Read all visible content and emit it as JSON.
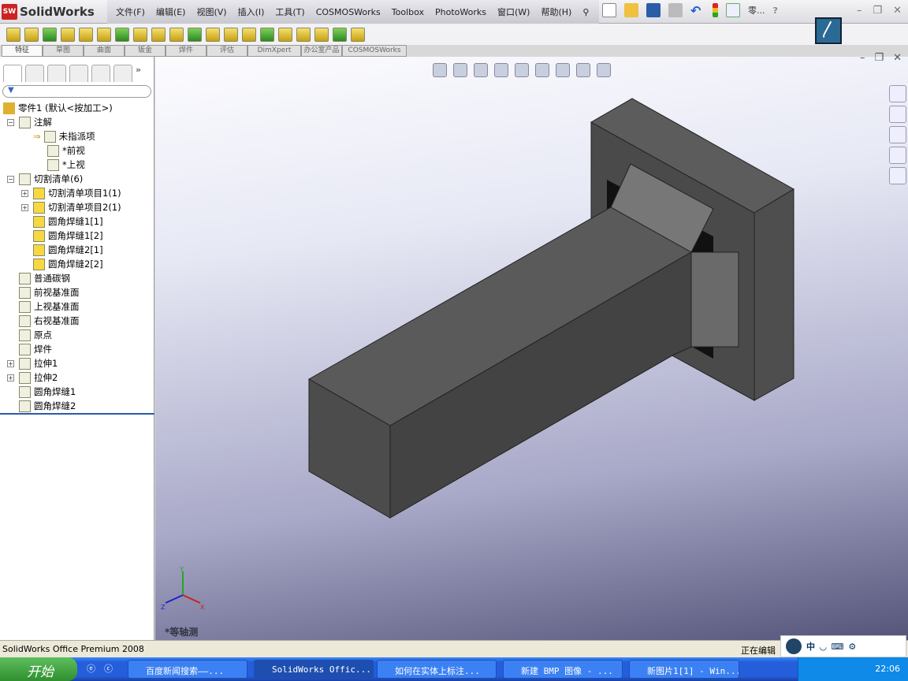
{
  "app": {
    "brand": "SolidWorks",
    "logo_text": "SW"
  },
  "menu": [
    "文件(F)",
    "编辑(E)",
    "视图(V)",
    "插入(I)",
    "工具(T)",
    "COSMOSWorks",
    "Toolbox",
    "PhotoWorks",
    "窗口(W)",
    "帮助(H)"
  ],
  "doc_short": "零...",
  "tabs": [
    "特征",
    "草图",
    "曲面",
    "钣金",
    "焊件",
    "评估",
    "DimXpert",
    "办公室产品",
    "COSMOSWorks"
  ],
  "tree": {
    "root": "零件1 (默认<按加工>)",
    "items": [
      {
        "label": "注解",
        "level": 1,
        "expander": "−"
      },
      {
        "label": "未指派项",
        "level": 3
      },
      {
        "label": "*前视",
        "level": 3
      },
      {
        "label": "*上视",
        "level": 3
      },
      {
        "label": "切割清单(6)",
        "level": 1,
        "expander": "−"
      },
      {
        "label": "切割清单项目1(1)",
        "level": 2,
        "expander": "+"
      },
      {
        "label": "切割清单项目2(1)",
        "level": 2,
        "expander": "+"
      },
      {
        "label": "圆角焊缝1[1]",
        "level": 2
      },
      {
        "label": "圆角焊缝1[2]",
        "level": 2
      },
      {
        "label": "圆角焊缝2[1]",
        "level": 2
      },
      {
        "label": "圆角焊缝2[2]",
        "level": 2
      },
      {
        "label": "普通碳钢",
        "level": 1
      },
      {
        "label": "前视基准面",
        "level": 1
      },
      {
        "label": "上视基准面",
        "level": 1
      },
      {
        "label": "右视基准面",
        "level": 1
      },
      {
        "label": "原点",
        "level": 1
      },
      {
        "label": "焊件",
        "level": 1
      },
      {
        "label": "拉伸1",
        "level": 1,
        "expander": "+"
      },
      {
        "label": "拉伸2",
        "level": 1,
        "expander": "+"
      },
      {
        "label": "圆角焊缝1",
        "level": 1
      },
      {
        "label": "圆角焊缝2",
        "level": 1
      }
    ]
  },
  "viewport": {
    "view_name": "*等轴测",
    "triad": {
      "x": "X",
      "y": "Y",
      "z": "Z"
    }
  },
  "status": {
    "product": "SolidWorks Office Premium 2008",
    "editing": "正在编辑"
  },
  "ime": {
    "mode": "中"
  },
  "taskbar": {
    "start": "开始",
    "buttons": [
      "百度新闻搜索——...",
      "SolidWorks Offic...",
      "如何在实体上标注...",
      "新建 BMP 图像 - ...",
      "新图片1[1] - Win..."
    ],
    "active": 1,
    "clock": "22:06"
  }
}
